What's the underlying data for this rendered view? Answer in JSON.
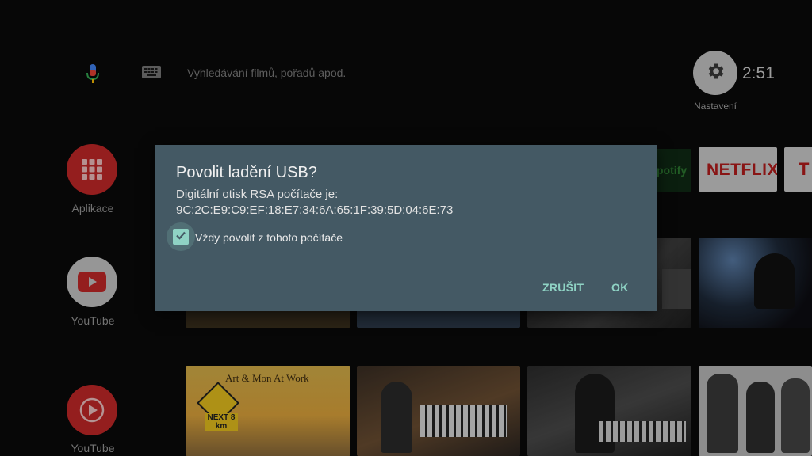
{
  "top_bar": {
    "search_hint": "Vyhledávání filmů, pořadů apod.",
    "settings_label": "Nastavení",
    "clock": "2:51"
  },
  "apps": [
    {
      "label": "Aplikace",
      "icon": "apps-grid-icon",
      "color": "#d32f2f"
    },
    {
      "label": "YouTube",
      "icon": "youtube-play-icon",
      "color": "#e53935"
    },
    {
      "label": "YouTube",
      "icon": "youtube-music-icon",
      "color": "#e53935"
    }
  ],
  "channel_logos": {
    "spotify": "potify",
    "netflix": "NETFLIX",
    "next": "T"
  },
  "thumbnails": {
    "music_at_work": "Art & Mon At Work",
    "sign": "NEXT 8 km"
  },
  "dialog": {
    "title": "Povolit ladění USB?",
    "line1": "Digitální otisk RSA počítače je:",
    "line2": "9C:2C:E9:C9:EF:18:E7:34:6A:65:1F:39:5D:04:6E:73",
    "checkbox_label": "Vždy povolit z tohoto počítače",
    "checkbox_checked": true,
    "cancel_label": "ZRUŠIT",
    "ok_label": "OK"
  },
  "colors": {
    "dialog_bg": "#445964",
    "accent": "#8fd3c4",
    "netflix_red": "#c62828"
  }
}
